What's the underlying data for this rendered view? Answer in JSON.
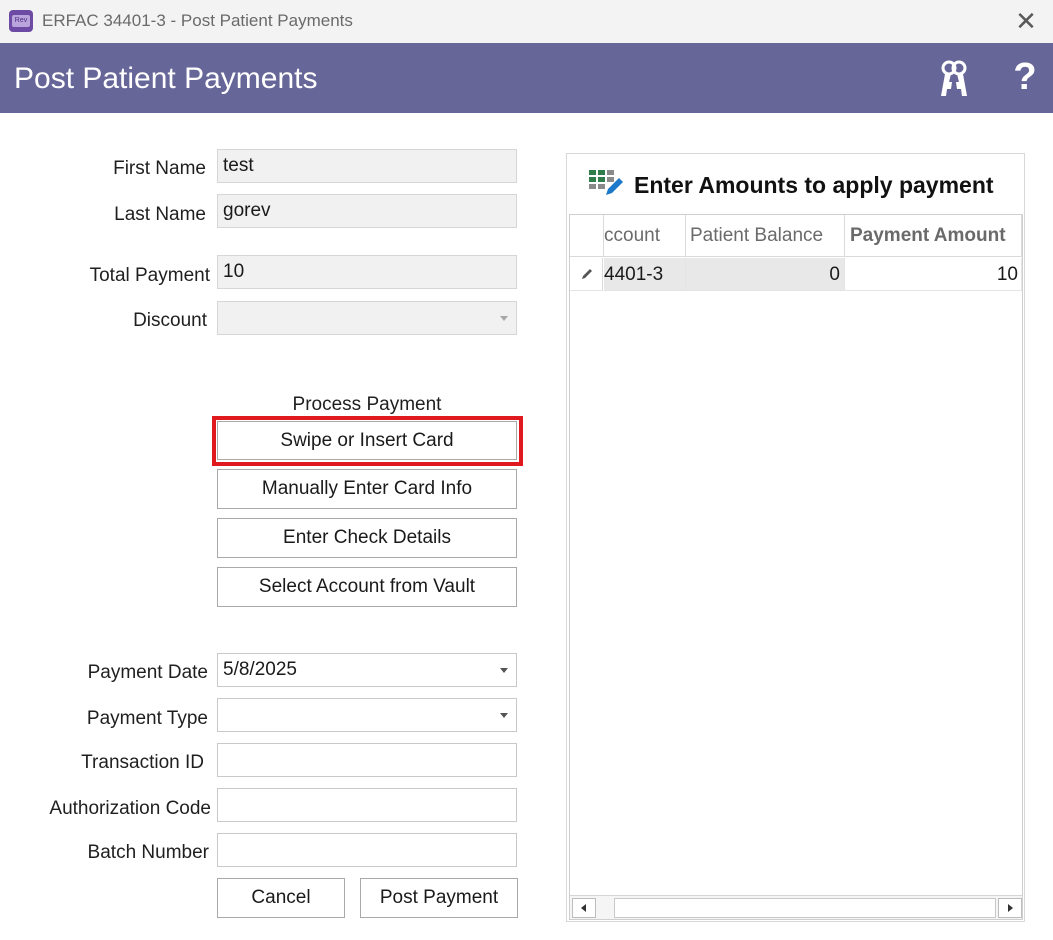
{
  "window": {
    "title": "ERFAC 34401-3 - Post Patient Payments",
    "close_glyph": "✕",
    "app_icon_text": "Rev"
  },
  "header": {
    "title": "Post Patient Payments",
    "help_glyph": "?",
    "bg_color": "#676698"
  },
  "form": {
    "first_name": {
      "label": "First Name",
      "value": "test"
    },
    "last_name": {
      "label": "Last Name",
      "value": "gorev"
    },
    "total_payment": {
      "label": "Total Payment",
      "value": "10"
    },
    "discount": {
      "label": "Discount",
      "value": ""
    }
  },
  "process": {
    "section_label": "Process Payment",
    "swipe_label": "Swipe or Insert Card",
    "manual_label": "Manually Enter Card Info",
    "check_label": "Enter Check Details",
    "vault_label": "Select Account from Vault",
    "highlight_color": "#e0191e"
  },
  "details": {
    "payment_date": {
      "label": "Payment Date",
      "value": "5/8/2025"
    },
    "payment_type": {
      "label": "Payment Type",
      "value": ""
    },
    "transaction_id": {
      "label": "Transaction ID",
      "value": ""
    },
    "authorization_code": {
      "label": "Authorization Code",
      "value": ""
    },
    "batch_number": {
      "label": "Batch Number",
      "value": ""
    }
  },
  "actions": {
    "cancel_label": "Cancel",
    "post_label": "Post Payment"
  },
  "grid": {
    "title": "Enter Amounts to apply payment",
    "columns": [
      "ccount",
      "Patient Balance",
      "Payment Amount"
    ],
    "rows": [
      {
        "account": "4401-3",
        "patient_balance": "0",
        "payment_amount": "10"
      }
    ]
  }
}
